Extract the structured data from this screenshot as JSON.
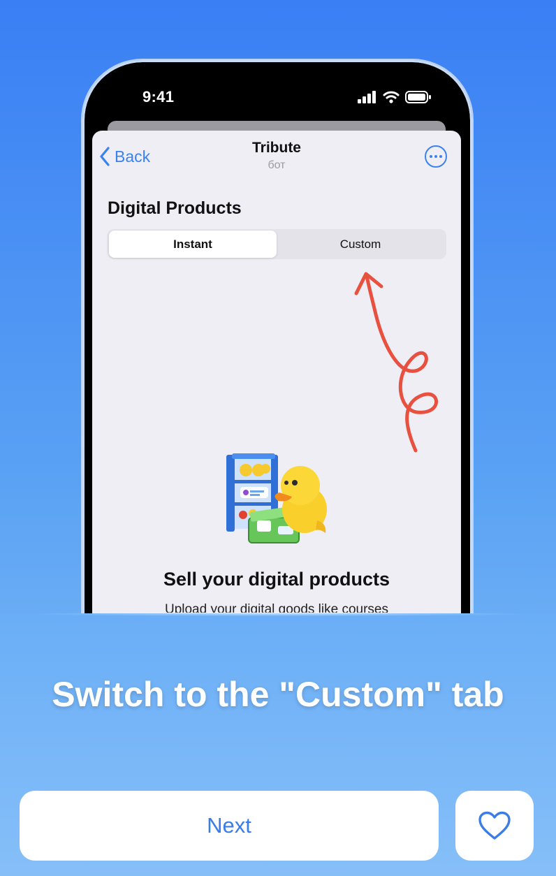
{
  "status_bar": {
    "time": "9:41",
    "icons": [
      "cellular-signal-icon",
      "wifi-icon",
      "battery-icon"
    ]
  },
  "nav": {
    "back_label": "Back",
    "title": "Tribute",
    "subtitle": "бот",
    "more_icon": "ellipsis-circle-icon"
  },
  "main": {
    "section_title": "Digital Products",
    "tabs": [
      {
        "label": "Instant",
        "selected": true
      },
      {
        "label": "Custom",
        "selected": false
      }
    ],
    "empty_state": {
      "title": "Sell your digital products",
      "description": "Upload your digital goods like courses"
    }
  },
  "instruction": "Switch to the \"Custom\" tab",
  "buttons": {
    "next_label": "Next",
    "like_icon": "heart-icon"
  },
  "colors": {
    "accent": "#3a82f0",
    "background_top": "#3a7ff4",
    "background_bottom": "#88c0f8",
    "arrow": "#e8503f"
  }
}
